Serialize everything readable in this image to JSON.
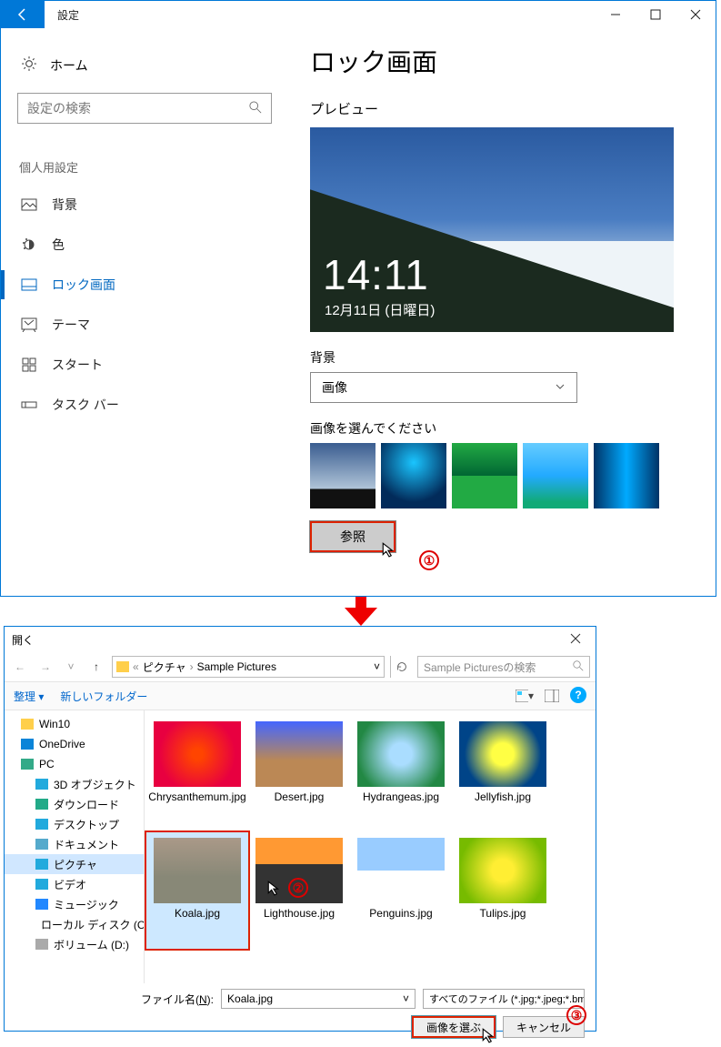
{
  "settings": {
    "title": "設定",
    "home": "ホーム",
    "search_placeholder": "設定の検索",
    "section": "個人用設定",
    "items": [
      {
        "label": "背景"
      },
      {
        "label": "色"
      },
      {
        "label": "ロック画面"
      },
      {
        "label": "テーマ"
      },
      {
        "label": "スタート"
      },
      {
        "label": "タスク バー"
      }
    ],
    "page_title": "ロック画面",
    "preview_label": "プレビュー",
    "clock": "14:11",
    "date": "12月11日 (日曜日)",
    "bg_label": "背景",
    "bg_value": "画像",
    "choose_label": "画像を選んでください",
    "browse": "参照"
  },
  "callouts": {
    "c1": "①",
    "c2": "②",
    "c3": "③"
  },
  "dialog": {
    "title": "開く",
    "path_parent": "ピクチャ",
    "path_current": "Sample Pictures",
    "search_placeholder": "Sample Picturesの検索",
    "organize": "整理",
    "new_folder": "新しいフォルダー",
    "tree": [
      {
        "label": "Win10",
        "ico": "ico-folder",
        "lvl": 1
      },
      {
        "label": "OneDrive",
        "ico": "ico-onedrive",
        "lvl": 1
      },
      {
        "label": "PC",
        "ico": "ico-pc",
        "lvl": 1
      },
      {
        "label": "3D オブジェクト",
        "ico": "ico-3d",
        "lvl": 2
      },
      {
        "label": "ダウンロード",
        "ico": "ico-dl",
        "lvl": 2
      },
      {
        "label": "デスクトップ",
        "ico": "ico-desk",
        "lvl": 2
      },
      {
        "label": "ドキュメント",
        "ico": "ico-doc",
        "lvl": 2
      },
      {
        "label": "ピクチャ",
        "ico": "ico-pic",
        "lvl": 2,
        "sel": true
      },
      {
        "label": "ビデオ",
        "ico": "ico-vid",
        "lvl": 2
      },
      {
        "label": "ミュージック",
        "ico": "ico-music",
        "lvl": 2
      },
      {
        "label": "ローカル ディスク (C",
        "ico": "ico-disk",
        "lvl": 2
      },
      {
        "label": "ボリューム (D:)",
        "ico": "ico-vol",
        "lvl": 2
      }
    ],
    "files": [
      {
        "label": "Chrysanthemum.jpg",
        "cls": "fa"
      },
      {
        "label": "Desert.jpg",
        "cls": "fb"
      },
      {
        "label": "Hydrangeas.jpg",
        "cls": "fc"
      },
      {
        "label": "Jellyfish.jpg",
        "cls": "fd"
      },
      {
        "label": "Koala.jpg",
        "cls": "fe",
        "sel": true
      },
      {
        "label": "Lighthouse.jpg",
        "cls": "ff"
      },
      {
        "label": "Penguins.jpg",
        "cls": "fg"
      },
      {
        "label": "Tulips.jpg",
        "cls": "fh"
      }
    ],
    "filename_label_pre": "ファイル名(",
    "filename_label_u": "N",
    "filename_label_post": "):",
    "filename_value": "Koala.jpg",
    "filetype": "すべてのファイル (*.jpg;*.jpeg;*.bmp",
    "open_btn": "画像を選ぶ",
    "cancel_btn": "キャンセル"
  }
}
